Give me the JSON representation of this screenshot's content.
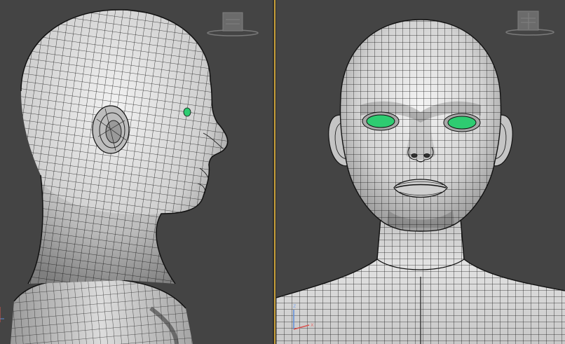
{
  "viewports": {
    "left": {
      "view": "side",
      "mesh": "head-wireframe"
    },
    "right": {
      "view": "front",
      "mesh": "head-wireframe"
    }
  },
  "gizmo": {
    "z_label": "z",
    "x_label": "x"
  },
  "colors": {
    "viewport_bg": "#444444",
    "mesh_shading": "#d8d8d8",
    "wire": "#1a1a1a",
    "eye": "#2ecc71",
    "active_border": "#c9a13a",
    "axis_x": "#d9534f",
    "axis_z": "#5b8bd9"
  }
}
